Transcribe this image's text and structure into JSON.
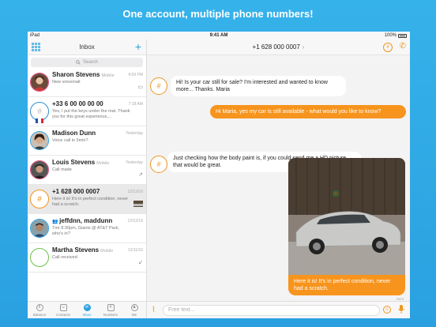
{
  "headline": "One account, multiple phone numbers!",
  "status_bar": {
    "device": "iPad",
    "time": "9:41 AM",
    "battery": "100%"
  },
  "sidebar": {
    "title": "Inbox",
    "search_placeholder": "Search",
    "conversations": [
      {
        "name": "Sharon Stevens",
        "sub": "Mobile",
        "time": "4:59 PM",
        "preview": "New voicemail",
        "icon": "voicemail-icon",
        "ring": "pink"
      },
      {
        "name": "+33 6 00 00 00 00",
        "sub": "",
        "time": "7:18 AM",
        "preview": "Yes, I put the keys under the mat. Thank you for this great experience,...",
        "icon": "",
        "ring": "blue"
      },
      {
        "name": "Madison Dunn",
        "sub": "",
        "time": "Yesterday",
        "preview": "Voice call in 5min?",
        "icon": "",
        "ring": "blue"
      },
      {
        "name": "Louis Stevens",
        "sub": "Mobile",
        "time": "Yesterday",
        "preview": "Call made",
        "icon": "outgoing-call-icon",
        "ring": "pink"
      },
      {
        "name": "+1 628 000 0007",
        "sub": "",
        "time": "12/13/16",
        "preview": "Here it is! It's in perfect condition, never had a scratch.",
        "icon": "image-thumb-icon",
        "ring": "orange"
      },
      {
        "name": "jeffdnn, maddunn",
        "sub": "",
        "time": "12/12/16",
        "preview": "Tmr 8:30pm, Giants @ AT&T Park, who's in?",
        "icon": "",
        "ring": "blue"
      },
      {
        "name": "Martha Stevens",
        "sub": "Mobile",
        "time": "12/11/16",
        "preview": "Call received",
        "icon": "incoming-call-icon",
        "ring": "green"
      }
    ],
    "tabs": [
      {
        "label": "Balance",
        "icon": "balance-icon"
      },
      {
        "label": "Contacts",
        "icon": "contacts-icon"
      },
      {
        "label": "Inbox",
        "icon": "inbox-icon"
      },
      {
        "label": "Numbers",
        "icon": "numbers-icon"
      },
      {
        "label": "Me",
        "icon": "me-icon"
      }
    ]
  },
  "chat": {
    "number": "+1 628 000 0007",
    "messages": [
      {
        "direction": "in",
        "text": "Hi! Is your car still for sale? I'm interested and wanted to know more... Thanks. Maria"
      },
      {
        "direction": "out",
        "text": "Hi Maria, yes my car is still available - what would you like to know?"
      },
      {
        "direction": "in",
        "text": "Just checking how the body paint is, if you could send me a HD picture that would be great."
      },
      {
        "direction": "out",
        "text": "Here it is! It's in perfect condition, never had a scratch."
      }
    ],
    "sent_label": "Sent",
    "composer_placeholder": "Free text..."
  },
  "colors": {
    "accent": "#f7941d",
    "brand_blue": "#2aa0e0",
    "background": "#36b2ea"
  }
}
